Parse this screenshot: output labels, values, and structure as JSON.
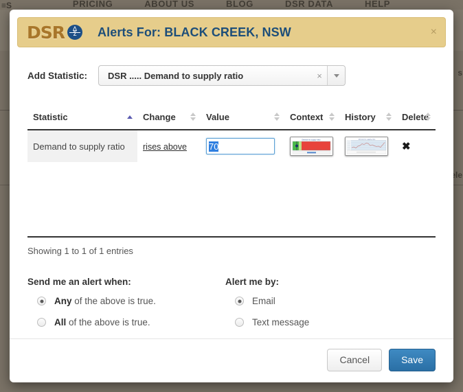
{
  "background": {
    "nav_items": [
      "PRICING",
      "ABOUT US",
      "BLOG",
      "DSR DATA",
      "HELP"
    ],
    "left_icon": "≡S",
    "fragment_right_top": "s",
    "fragment_right_mid": "ele"
  },
  "modal": {
    "logo_text": "DSR",
    "logo_mark_top": "Δ",
    "logo_mark_bottom": "Σ",
    "title": "Alerts For: BLACK CREEK, NSW",
    "close_icon": "×",
    "add_statistic": {
      "label": "Add Statistic:",
      "selected_value": "DSR ..... Demand to supply ratio",
      "clear_icon": "×",
      "dropdown_icon": "chevron-down-icon"
    },
    "table": {
      "columns": [
        {
          "label": "Statistic",
          "sort": "asc"
        },
        {
          "label": "Change",
          "sort": "none"
        },
        {
          "label": "Value",
          "sort": "none"
        },
        {
          "label": "Context",
          "sort": "none"
        },
        {
          "label": "History",
          "sort": "none"
        },
        {
          "label": "Delete",
          "sort": "none"
        }
      ],
      "rows": [
        {
          "statistic": "Demand to supply ratio",
          "change": "rises above",
          "value": "70",
          "context_thumb": "gauge-thumbnail",
          "history_thumb": "line-chart-thumbnail",
          "delete_icon": "✖"
        }
      ],
      "showing_entries": "Showing 1 to 1 of 1 entries"
    },
    "alert_when": {
      "title": "Send me an alert when:",
      "options": [
        {
          "strong": "Any",
          "rest": " of the above is true.",
          "checked": true
        },
        {
          "strong": "All",
          "rest": " of the above is true.",
          "checked": false
        }
      ]
    },
    "alert_by": {
      "title": "Alert me by:",
      "options": [
        {
          "strong": "",
          "rest": "Email",
          "checked": true
        },
        {
          "strong": "",
          "rest": "Text message",
          "checked": false
        }
      ]
    },
    "footer": {
      "cancel_label": "Cancel",
      "save_label": "Save"
    }
  },
  "colors": {
    "header_band": "#e6cd8b",
    "title_blue": "#1d4e79",
    "logo_gold": "#a8762a",
    "primary_blue": "#2a6fa5",
    "sort_active": "#5a5ab0",
    "backdrop": "#7a7266"
  }
}
